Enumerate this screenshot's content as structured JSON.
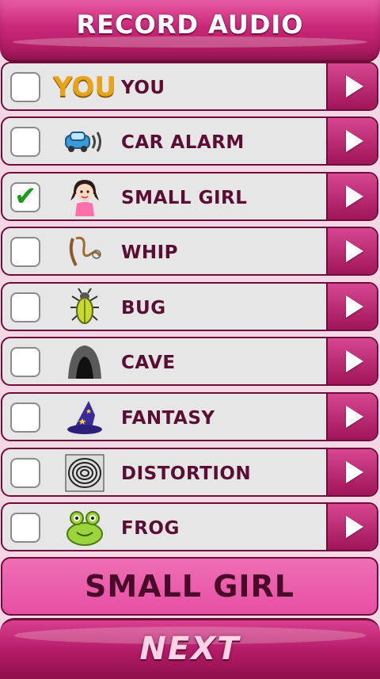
{
  "header": {
    "title": "RECORD AUDIO"
  },
  "effects": [
    {
      "label": "YOU",
      "icon": "you-text-icon",
      "checked": false
    },
    {
      "label": "CAR ALARM",
      "icon": "car-alarm-icon",
      "checked": false
    },
    {
      "label": "SMALL GIRL",
      "icon": "small-girl-icon",
      "checked": true
    },
    {
      "label": "WHIP",
      "icon": "whip-icon",
      "checked": false
    },
    {
      "label": "BUG",
      "icon": "bug-icon",
      "checked": false
    },
    {
      "label": "CAVE",
      "icon": "cave-icon",
      "checked": false
    },
    {
      "label": "FANTASY",
      "icon": "wizard-hat-icon",
      "checked": false
    },
    {
      "label": "DISTORTION",
      "icon": "distortion-icon",
      "checked": false
    },
    {
      "label": "FROG",
      "icon": "frog-icon",
      "checked": false
    }
  ],
  "you_icon_text": "YOU",
  "selected": {
    "label": "SMALL GIRL"
  },
  "footer": {
    "next_label": "NEXT"
  },
  "colors": {
    "accent": "#c92878",
    "dark": "#6e0d3b",
    "check": "#1f9a1f"
  }
}
